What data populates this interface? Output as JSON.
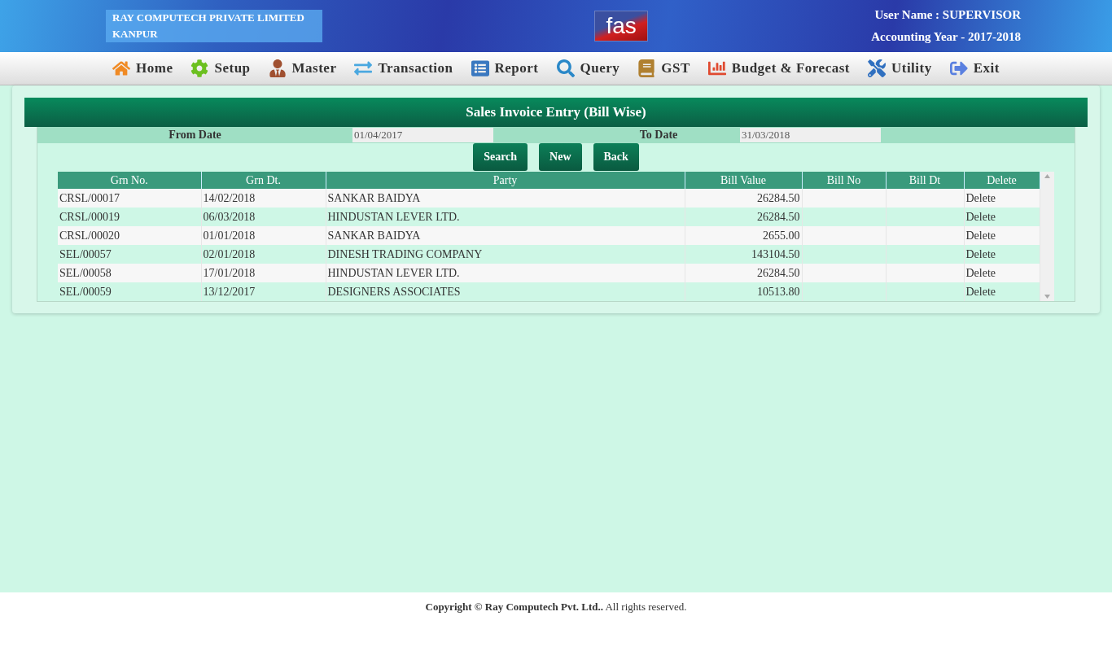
{
  "header": {
    "company": "RAY COMPUTECH PRIVATE LIMITED",
    "city": "KANPUR",
    "logo": "fas",
    "user": "User Name : SUPERVISOR",
    "year": "Accounting Year - 2017-2018"
  },
  "menu": [
    {
      "label": "Home"
    },
    {
      "label": "Setup"
    },
    {
      "label": "Master"
    },
    {
      "label": "Transaction"
    },
    {
      "label": "Report"
    },
    {
      "label": "Query"
    },
    {
      "label": "GST"
    },
    {
      "label": "Budget & Forecast"
    },
    {
      "label": "Utility"
    },
    {
      "label": "Exit"
    }
  ],
  "form": {
    "title": "Sales Invoice Entry (Bill Wise)",
    "from_label": "From Date",
    "from_value": "01/04/2017",
    "to_label": "To Date",
    "to_value": "31/03/2018",
    "buttons": [
      "Search",
      "New",
      "Back"
    ]
  },
  "table": {
    "columns": [
      "Grn No.",
      "Grn Dt.",
      "Party",
      "Bill Value",
      "Bill No",
      "Bill Dt",
      "Delete"
    ],
    "rows": [
      [
        "CRSL/00017",
        "14/02/2018",
        "SANKAR BAIDYA",
        "26284.50",
        "",
        "",
        "Delete"
      ],
      [
        "CRSL/00019",
        "06/03/2018",
        "HINDUSTAN LEVER LTD.",
        "26284.50",
        "",
        "",
        "Delete"
      ],
      [
        "CRSL/00020",
        "01/01/2018",
        "SANKAR BAIDYA",
        "2655.00",
        "",
        "",
        "Delete"
      ],
      [
        "SEL/00057",
        "02/01/2018",
        "DINESH TRADING COMPANY",
        "143104.50",
        "",
        "",
        "Delete"
      ],
      [
        "SEL/00058",
        "17/01/2018",
        "HINDUSTAN LEVER LTD.",
        "26284.50",
        "",
        "",
        "Delete"
      ],
      [
        "SEL/00059",
        "13/12/2017",
        "DESIGNERS ASSOCIATES",
        "10513.80",
        "",
        "",
        "Delete"
      ]
    ]
  },
  "footer": {
    "text": "**Copyright © Ray Computech Pvt. Ltd..** All rights reserved."
  }
}
